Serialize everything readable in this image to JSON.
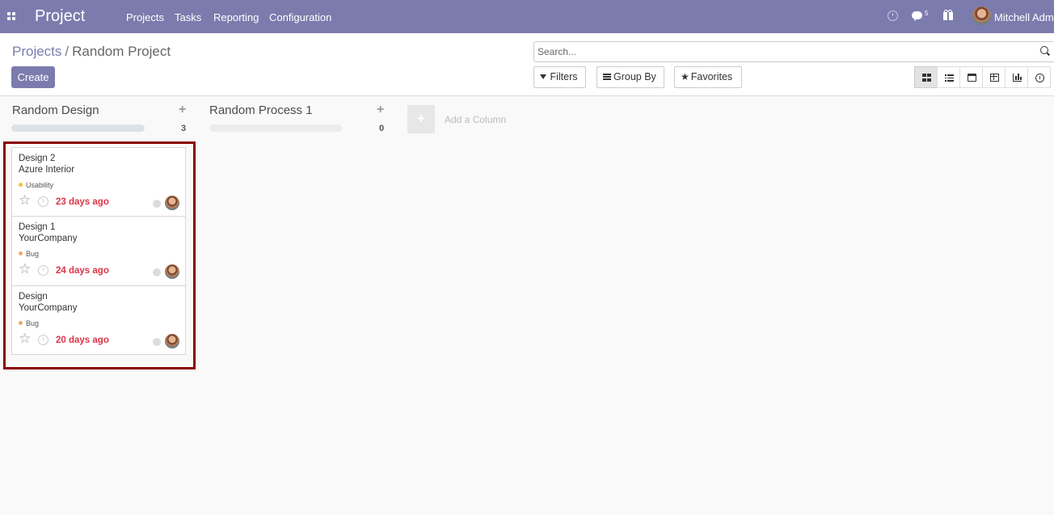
{
  "navbar": {
    "app_title": "Project",
    "menu": [
      "Projects",
      "Tasks",
      "Reporting",
      "Configuration"
    ],
    "messages_count": "5",
    "user_name": "Mitchell Admin"
  },
  "control_panel": {
    "breadcrumb_parent": "Projects",
    "breadcrumb_separator": "/",
    "breadcrumb_current": "Random Project",
    "create_label": "Create",
    "search_placeholder": "Search...",
    "filters_label": "Filters",
    "group_by_label": "Group By",
    "favorites_label": "Favorites",
    "views": [
      "kanban-icon",
      "list-icon",
      "calendar-icon",
      "pivot-icon",
      "graph-icon",
      "activity-icon"
    ],
    "active_view": "kanban"
  },
  "kanban": {
    "columns": [
      {
        "title": "Random Design",
        "add_symbol": "+",
        "count": "3",
        "progress_fraction": 1.0
      },
      {
        "title": "Random Process 1",
        "add_symbol": "+",
        "count": "0",
        "progress_fraction": 0.0
      }
    ],
    "add_column_symbol": "+",
    "add_column_label": "Add a Column",
    "cards": [
      {
        "name": "Design 2",
        "partner": "Azure Interior",
        "tag": "Usability",
        "tag_color": "#f4c430",
        "deadline": "23 days ago"
      },
      {
        "name": "Design 1",
        "partner": "YourCompany",
        "tag": "Bug",
        "tag_color": "#f0a86a",
        "deadline": "24 days ago"
      },
      {
        "name": "Design",
        "partner": "YourCompany",
        "tag": "Bug",
        "tag_color": "#f0a86a",
        "deadline": "20 days ago"
      }
    ],
    "star_symbol": "☆"
  },
  "colors": {
    "brand": "#7c7bad",
    "deadline_overdue": "#dc3545",
    "highlight_border": "#8b0000"
  }
}
